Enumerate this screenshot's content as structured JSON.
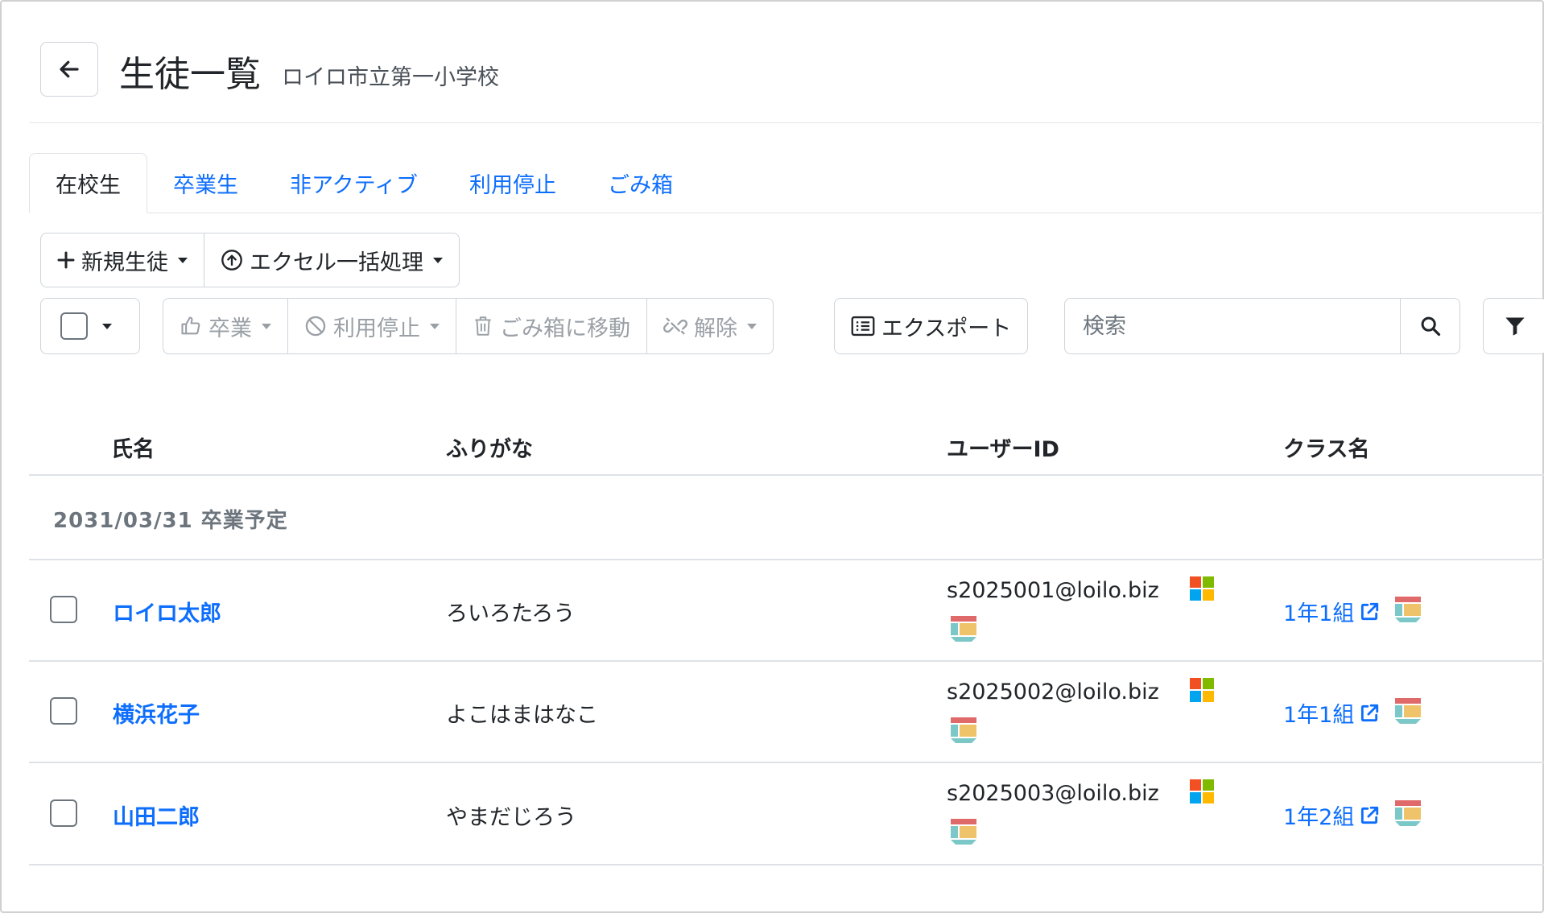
{
  "header": {
    "title": "生徒一覧",
    "subtitle": "ロイロ市立第一小学校"
  },
  "tabs": [
    {
      "label": "在校生",
      "active": true
    },
    {
      "label": "卒業生",
      "active": false
    },
    {
      "label": "非アクティブ",
      "active": false
    },
    {
      "label": "利用停止",
      "active": false
    },
    {
      "label": "ごみ箱",
      "active": false
    }
  ],
  "toolbar": {
    "new_student": "新規生徒",
    "excel_bulk": "エクセル一括処理",
    "graduate": "卒業",
    "suspend": "利用停止",
    "move_to_trash": "ごみ箱に移動",
    "release": "解除",
    "export": "エクスポート"
  },
  "search": {
    "placeholder": "検索"
  },
  "table": {
    "columns": [
      "氏名",
      "ふりがな",
      "ユーザーID",
      "クラス名"
    ],
    "group_label": "2031/03/31 卒業予定",
    "rows": [
      {
        "name": "ロイロ太郎",
        "furigana": "ろいろたろう",
        "user_id": "s2025001@loilo.biz",
        "class_name": "1年1組"
      },
      {
        "name": "横浜花子",
        "furigana": "よこはまはなこ",
        "user_id": "s2025002@loilo.biz",
        "class_name": "1年1組"
      },
      {
        "name": "山田二郎",
        "furigana": "やまだじろう",
        "user_id": "s2025003@loilo.biz",
        "class_name": "1年2組"
      }
    ]
  },
  "colors": {
    "link": "#0d6efd",
    "border": "#ced4da",
    "muted": "#6c757d",
    "ms_red": "#f25022",
    "ms_green": "#7fba00",
    "ms_blue": "#00a4ef",
    "ms_yellow": "#ffb900"
  },
  "icons": {
    "back": "arrow-left-icon",
    "search": "search-icon",
    "filter": "filter-icon",
    "microsoft": "microsoft-logo-icon",
    "loilo": "loilonote-logo-icon",
    "external": "external-link-icon"
  }
}
